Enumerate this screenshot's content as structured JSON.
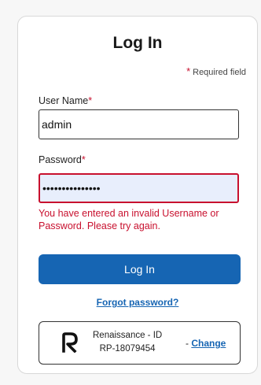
{
  "login_card": {
    "title": "Log In",
    "required_star": "*",
    "required_note": "Required field",
    "username": {
      "label": "User Name",
      "star": "*",
      "value": "admin"
    },
    "password": {
      "label": "Password",
      "star": "*",
      "masked_value": "•••••••••••••••"
    },
    "error_message": "You have entered an invalid Username or Password. Please try again.",
    "login_button": "Log In",
    "forgot_password": "Forgot password?",
    "renaissance_id": {
      "line1": "Renaissance - ID",
      "line2": "RP-18079454",
      "change_prefix": "- ",
      "change_link": "Change",
      "logo_icon": "renaissance-logo-icon"
    }
  },
  "colors": {
    "accent": "#1665b3",
    "error": "#c8102e",
    "password_fill": "#e8eefc"
  }
}
